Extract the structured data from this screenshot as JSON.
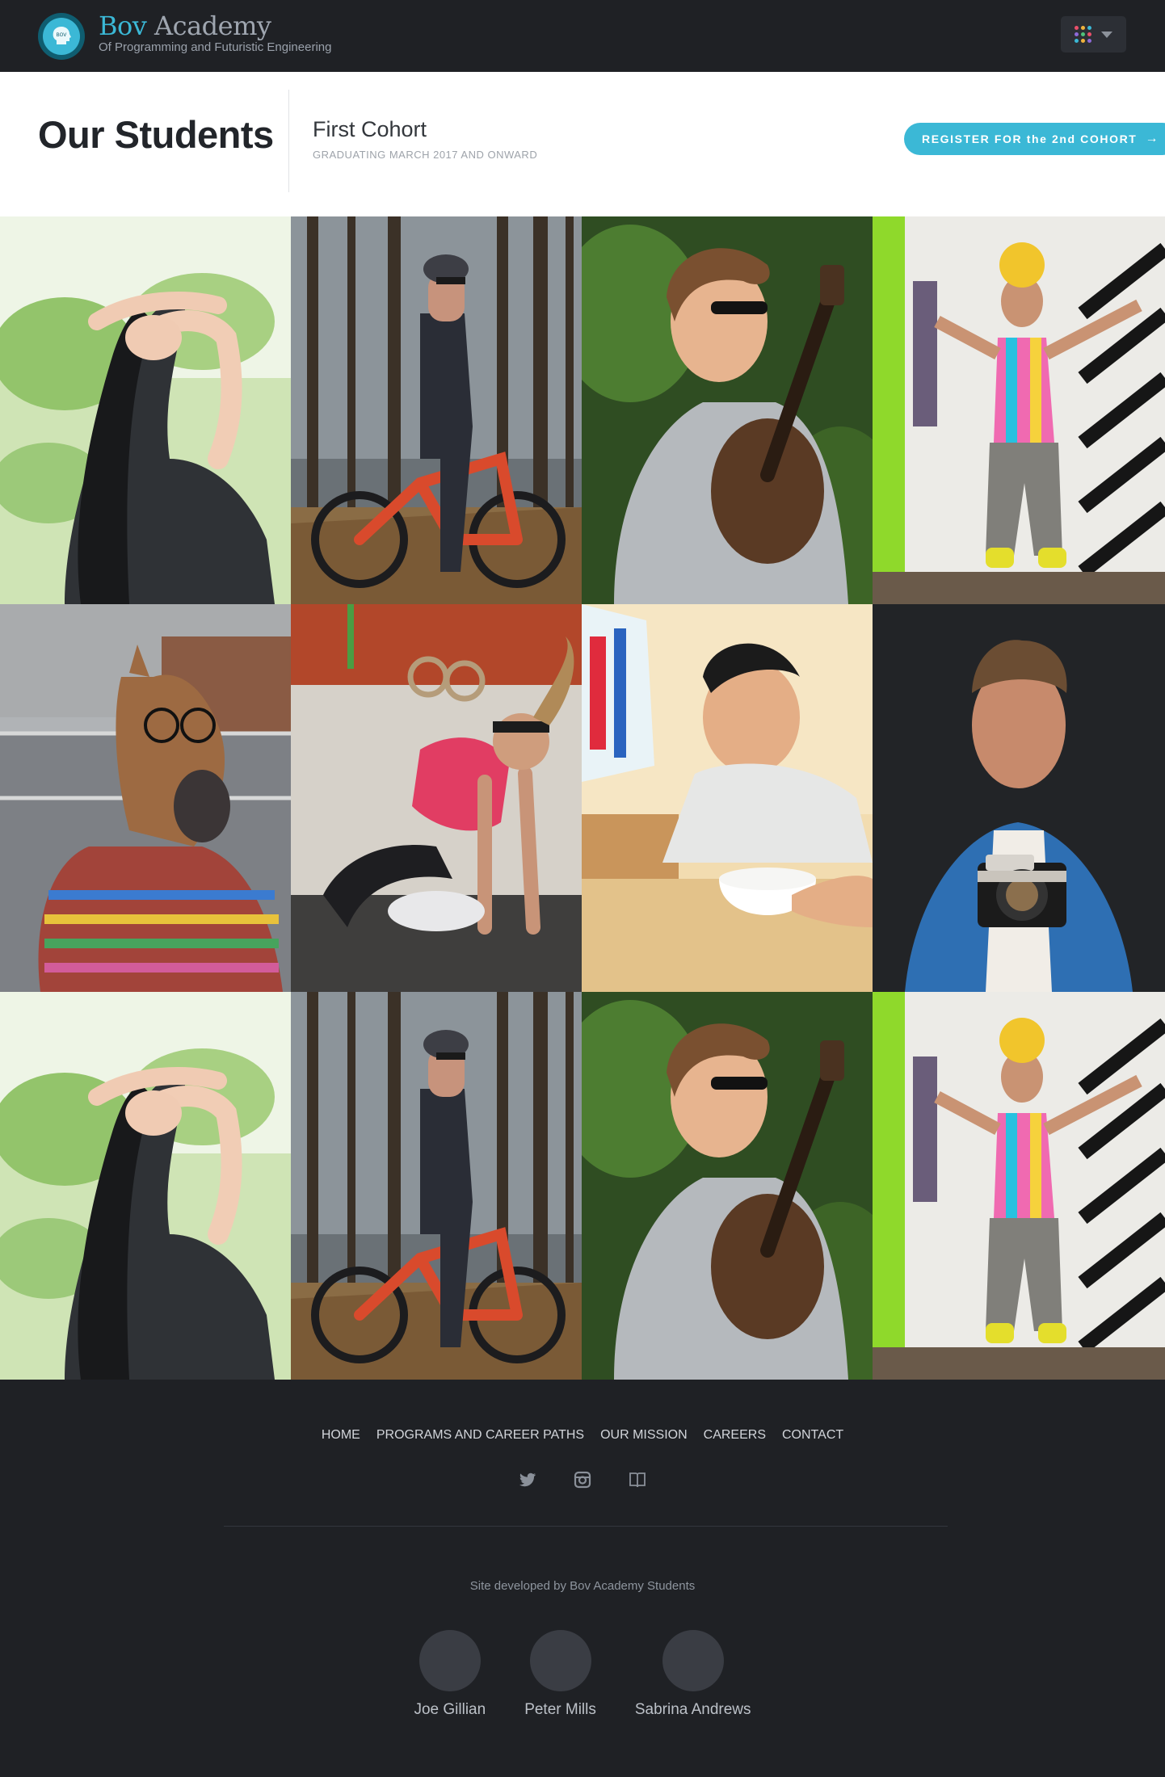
{
  "header": {
    "brand_primary": "Bov",
    "brand_secondary": "Academy",
    "tagline": "Of Programming and Futuristic Engineering",
    "logo_text": "BOV",
    "menu_icon": "apps-grid-icon",
    "accent_color": "#3bb8d6"
  },
  "band": {
    "title": "Our Students",
    "cohort": "First Cohort",
    "graduation": "GRADUATING MARCH 2017 AND ONWARD",
    "register_label": "REGISTER FOR the 2nd COHORT",
    "register_arrow": "→"
  },
  "gallery": [
    {
      "subject": "woman-stretching"
    },
    {
      "subject": "mountain-biker"
    },
    {
      "subject": "man-with-ukulele"
    },
    {
      "subject": "colorful-costume-man"
    },
    {
      "subject": "horse-mask-person"
    },
    {
      "subject": "woman-pushups"
    },
    {
      "subject": "man-yawning-cereal"
    },
    {
      "subject": "man-with-camera"
    },
    {
      "subject": "woman-stretching"
    },
    {
      "subject": "mountain-biker"
    },
    {
      "subject": "man-with-ukulele"
    },
    {
      "subject": "colorful-costume-man"
    }
  ],
  "footer": {
    "nav": [
      "HOME",
      "PROGRAMS AND CAREER PATHS",
      "OUR MISSION",
      "CAREERS",
      "CONTACT"
    ],
    "social_icons": [
      "twitter-icon",
      "instagram-icon",
      "book-icon"
    ],
    "credit": "Site developed by Bov Academy Students",
    "people": [
      "Joe Gillian",
      "Peter Mills",
      "Sabrina Andrews"
    ]
  }
}
